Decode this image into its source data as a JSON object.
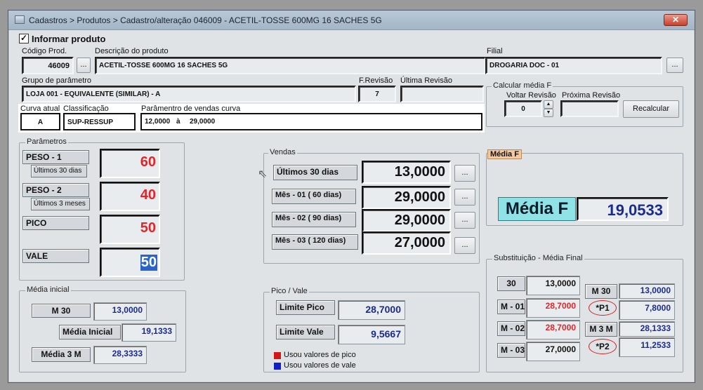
{
  "window": {
    "title": "Cadastros > Produtos > Cadastro/alteração  046009 - ACETIL-TOSSE 600MG 16 SACHES 5G",
    "close": "✕"
  },
  "header": {
    "informar_produto": "Informar produto",
    "informar_checked": true,
    "codigo_label": "Código Prod.",
    "codigo_value": "46009",
    "descricao_label": "Descrição do  produto",
    "descricao_value": "ACETIL-TOSSE 600MG 16 SACHES 5G",
    "filial_label": "Filial",
    "filial_value": "DROGARIA DOC - 01",
    "ellipsis": "...",
    "grupo_label": "Grupo de parâmetro",
    "grupo_value": "LOJA 001 - EQUIVALENTE (SIMILAR) - A",
    "frevisao_label": "F.Revisão",
    "frevisao_value": "7",
    "ultima_label": "Última Revisão",
    "ultima_value": "",
    "curva_label": "Curva atual",
    "curva_value": "A",
    "classificacao_label": "Classificação",
    "classificacao_value": "SUP-RESSUP",
    "param_curva_label": "Parâmentro de vendas curva",
    "param_curva_from": "12,0000",
    "param_curva_a": "à",
    "param_curva_to": "29,0000"
  },
  "calc_media": {
    "title": "Calcular média F",
    "voltar_label": "Voltar Revisão",
    "voltar_value": "0",
    "proxima_label": "Próxima Revisão",
    "proxima_value": "",
    "recalcular": "Recalcular",
    "spin_up": "▲",
    "spin_down": "▼"
  },
  "parametros": {
    "title": "Parâmetros",
    "items": [
      {
        "label": "PESO - 1",
        "sub": "Últimos 30 dias",
        "value": "60"
      },
      {
        "label": "PESO - 2",
        "sub": "Últimos 3 meses",
        "value": "40"
      },
      {
        "label": "PICO",
        "sub": "",
        "value": "50"
      },
      {
        "label": "VALE",
        "sub": "",
        "value": "50"
      }
    ]
  },
  "vendas": {
    "title": "Vendas",
    "rows": [
      {
        "label": "Últimos 30 dias",
        "value": "13,0000"
      },
      {
        "label": "Mês - 01 ( 60 dias)",
        "value": "29,0000"
      },
      {
        "label": "Mês - 02 ( 90 dias)",
        "value": "29,0000"
      },
      {
        "label": "Mês - 03 ( 120 dias)",
        "value": "27,0000"
      }
    ],
    "button": "..."
  },
  "media_f": {
    "title": "Média F",
    "label": "Média F",
    "value": "19,0533"
  },
  "media_inicial": {
    "title": "Média inicial",
    "m30_label": "M 30",
    "m30_value": "13,0000",
    "media_inicial_label": "Média Inicial",
    "media_inicial_value": "19,1333",
    "media3m_label": "Média 3 M",
    "media3m_value": "28,3333"
  },
  "pico_vale": {
    "title": "Pico / Vale",
    "limite_pico_label": "Limite Pico",
    "limite_pico_value": "28,7000",
    "limite_vale_label": "Limite Vale",
    "limite_vale_value": "9,5667",
    "legend_pico": "Usou valores de pico",
    "legend_vale": "Usou valores de vale",
    "color_pico": "#d01818",
    "color_vale": "#1020c8"
  },
  "substituicao": {
    "title": "Substituição - Média Final",
    "left": [
      {
        "label": "30",
        "value": "13,0000",
        "color": "black"
      },
      {
        "label": "M - 01",
        "value": "28,7000",
        "color": "red"
      },
      {
        "label": "M - 02",
        "value": "28,7000",
        "color": "red"
      },
      {
        "label": "M - 03",
        "value": "27,0000",
        "color": "black"
      }
    ],
    "right": [
      {
        "label": "M 30",
        "value": "13,0000"
      },
      {
        "label": "*P1",
        "value": "7,8000"
      },
      {
        "label": "M 3 M",
        "value": "28,1333"
      },
      {
        "label": "*P2",
        "value": "11,2533"
      }
    ]
  }
}
